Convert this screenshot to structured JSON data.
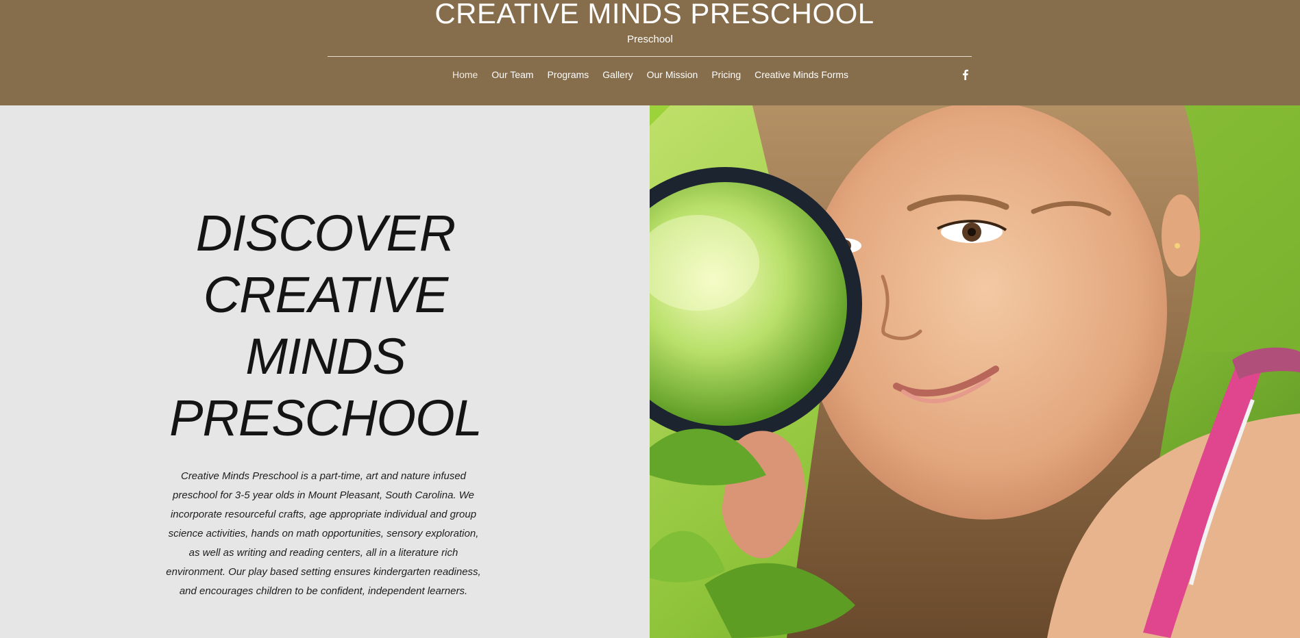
{
  "header": {
    "site_title": "CREATIVE MINDS PRESCHOOL",
    "site_subtitle": "Preschool",
    "nav_items": [
      {
        "label": "Home",
        "active": true
      },
      {
        "label": "Our Team"
      },
      {
        "label": "Programs"
      },
      {
        "label": "Gallery"
      },
      {
        "label": "Our Mission"
      },
      {
        "label": "Pricing"
      },
      {
        "label": "Creative Minds Forms"
      }
    ],
    "social_icon": "facebook-icon"
  },
  "hero": {
    "heading_lines": [
      "DISCOVER",
      "CREATIVE",
      "MINDS",
      "PRESCHOOL"
    ],
    "description": "Creative Minds Preschool is a part-time, art and nature infused preschool for 3-5 year olds in Mount Pleasant, South Carolina.  We incorporate resourceful crafts, age appropriate individual and group science activities, hands on math opportunities, sensory exploration, as well as writing and reading centers, all in a literature rich environment.  Our play based setting ensures kindergarten readiness, and encourages children to be confident, independent learners."
  },
  "colors": {
    "header_bg": "#866d4b",
    "panel_bg": "#e6e6e6",
    "text_dark": "#141414"
  }
}
